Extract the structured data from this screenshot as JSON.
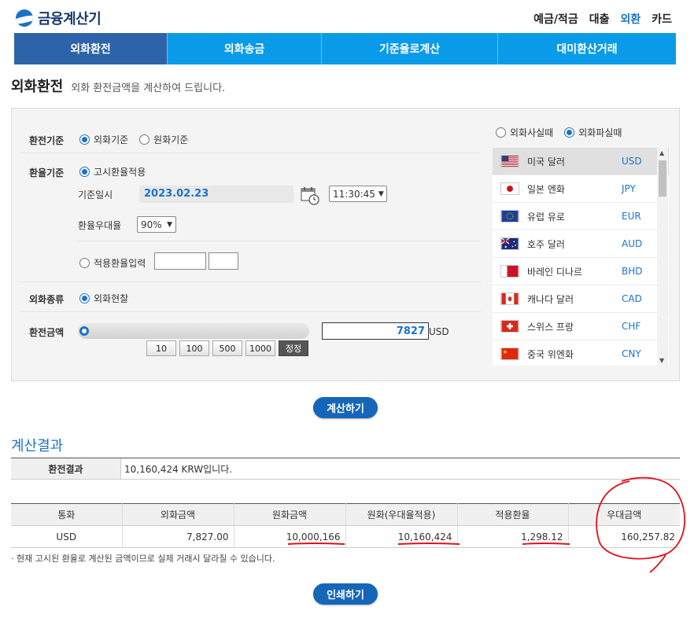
{
  "header": {
    "logo_text": "금융계산기",
    "nav": [
      "예금/적금",
      "대출",
      "외환",
      "카드"
    ],
    "nav_active": 2
  },
  "tabs": [
    "외화환전",
    "외화송금",
    "기준율로계산",
    "대미환산거래"
  ],
  "page": {
    "title": "외화환전",
    "subtitle": "외화 환전금액을 계산하여 드립니다."
  },
  "form": {
    "basis_label": "환전기준",
    "basis_options": [
      "외화기준",
      "원화기준"
    ],
    "rate_label": "환율기준",
    "rate_notice": "고시환율적용",
    "date_label": "기준일시",
    "date_value": "2023.02.23",
    "time_value": "11:30:45",
    "discount_label": "환율우대율",
    "discount_value": "90%",
    "manual_rate": "적용환율입력",
    "type_label": "외화종류",
    "type_option": "외화현찰",
    "amount_label": "환전금액",
    "amount_value": "7827",
    "amount_unit": "USD",
    "quick": [
      "10",
      "100",
      "500",
      "1000",
      "정정"
    ]
  },
  "currency_mode": [
    "외화사실때",
    "외화파실때"
  ],
  "currencies": [
    {
      "name": "미국 달러",
      "code": "USD"
    },
    {
      "name": "일본 엔화",
      "code": "JPY"
    },
    {
      "name": "유럽 유로",
      "code": "EUR"
    },
    {
      "name": "호주 달러",
      "code": "AUD"
    },
    {
      "name": "바레인 디나르",
      "code": "BHD"
    },
    {
      "name": "캐나다 달러",
      "code": "CAD"
    },
    {
      "name": "스위스 프랑",
      "code": "CHF"
    },
    {
      "name": "중국 위엔화",
      "code": "CNY"
    }
  ],
  "buttons": {
    "calculate": "계산하기",
    "print": "인쇄하기"
  },
  "result": {
    "title": "계산결과",
    "summary_label": "환전결과",
    "summary_value": "10,160,424 KRW입니다.",
    "headers": [
      "통화",
      "외화금액",
      "원화금액",
      "원화(우대율적용)",
      "적용환율",
      "우대금액"
    ],
    "row": [
      "USD",
      "7,827.00",
      "10,000,166",
      "10,160,424",
      "1,298.12",
      "160,257.82"
    ],
    "note": "· 현재 고시된 환율로 계산된 금액이므로 실제 거래시 달라질 수 있습니다."
  },
  "colors": {
    "accent": "#1a73c9",
    "tab_bar": "#0a9be8",
    "tab_active": "#2d63a8",
    "annotation": "#e0101a"
  }
}
